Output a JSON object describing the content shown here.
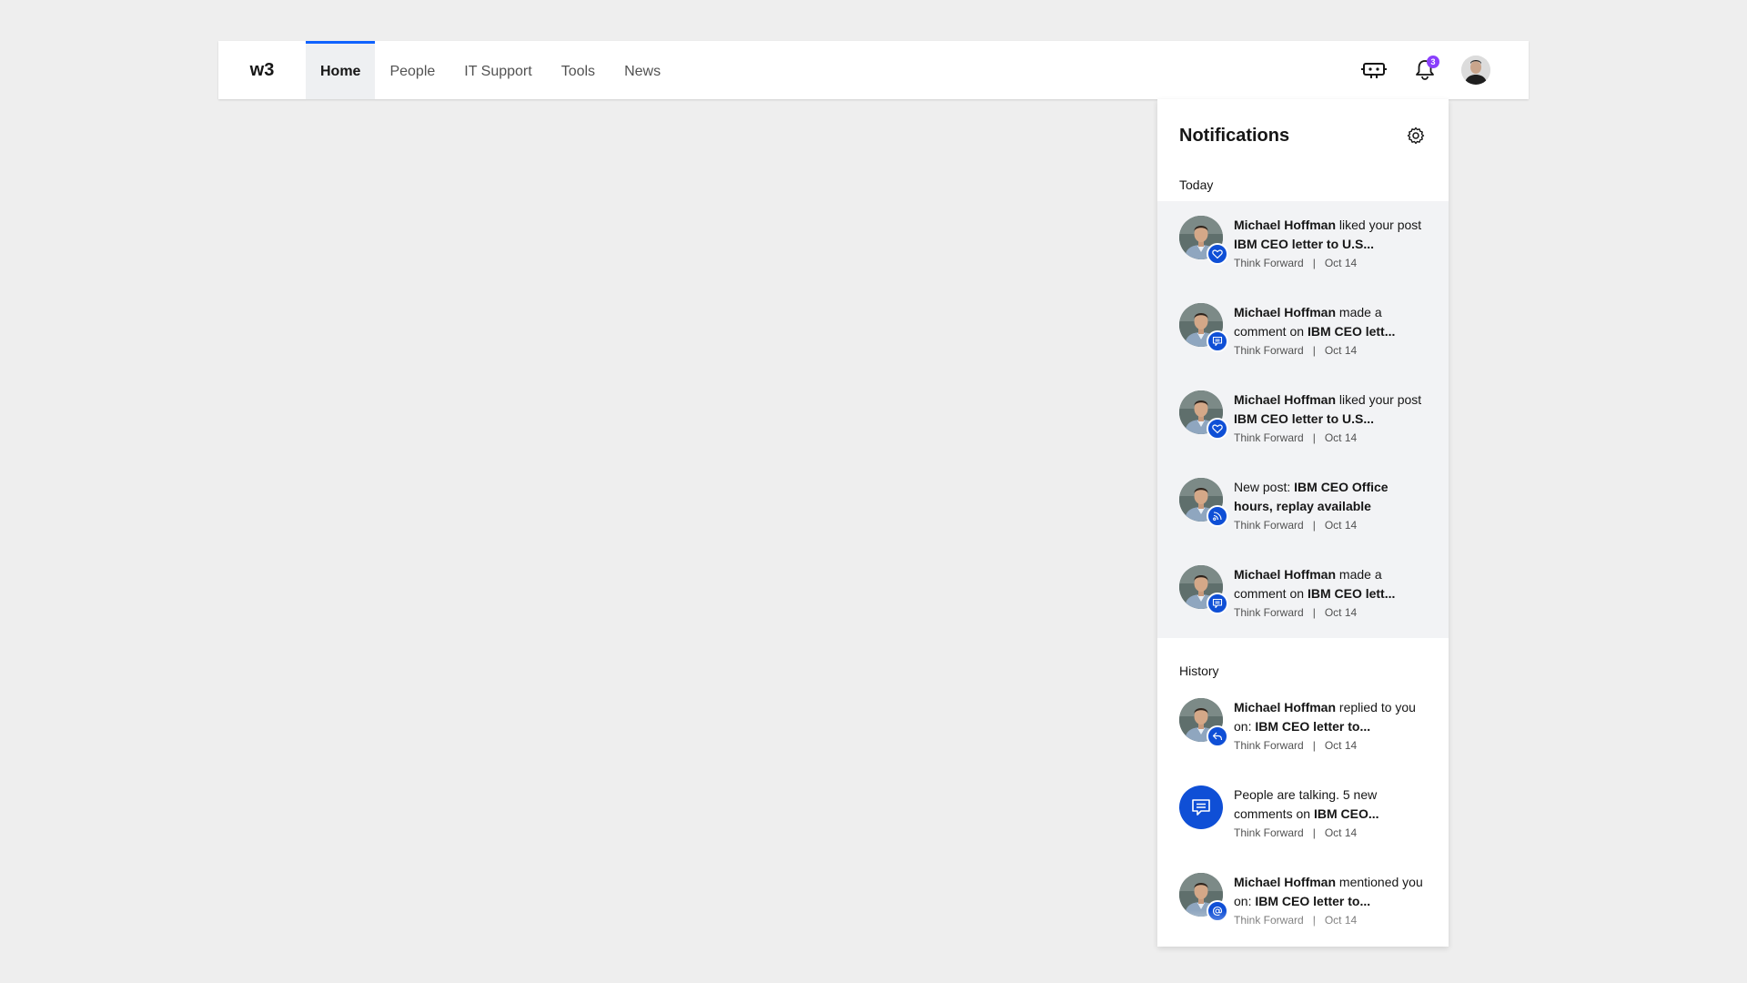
{
  "header": {
    "logo": "w3",
    "nav": [
      {
        "label": "Home",
        "active": true
      },
      {
        "label": "People"
      },
      {
        "label": "IT Support"
      },
      {
        "label": "Tools"
      },
      {
        "label": "News"
      }
    ],
    "notification_count": "3"
  },
  "panel": {
    "title": "Notifications",
    "today_label": "Today",
    "history_label": "History",
    "separator": "|",
    "today": [
      {
        "actor": "Michael Hoffman",
        "action": " liked your post ",
        "target": "IBM CEO letter to U.S...",
        "source": "Think Forward",
        "date": "Oct 14",
        "icon": "heart-icon"
      },
      {
        "actor": "Michael Hoffman",
        "action": " made a comment on ",
        "target": "IBM CEO lett...",
        "source": "Think Forward",
        "date": "Oct 14",
        "icon": "comment-icon"
      },
      {
        "actor": "Michael Hoffman",
        "action": " liked your post ",
        "target": "IBM CEO letter to U.S...",
        "source": "Think Forward",
        "date": "Oct 14",
        "icon": "heart-icon"
      },
      {
        "actor": "",
        "action": "New post: ",
        "target": "IBM CEO Office hours, replay available",
        "source": "Think Forward",
        "date": "Oct 14",
        "icon": "rss-icon"
      },
      {
        "actor": "Michael Hoffman",
        "action": " made a comment on ",
        "target": "IBM CEO lett...",
        "source": "Think Forward",
        "date": "Oct 14",
        "icon": "comment-icon"
      }
    ],
    "history": [
      {
        "actor": "Michael Hoffman",
        "action": " replied to you on: ",
        "target": "IBM CEO letter to...",
        "source": "Think Forward",
        "date": "Oct 14",
        "icon": "reply-icon"
      },
      {
        "actor": "",
        "action": "People are talking. 5 new comments on ",
        "target": "IBM CEO...",
        "source": "Think Forward",
        "date": "Oct 14",
        "icon": "comment-icon",
        "no_avatar": true
      },
      {
        "actor": "Michael Hoffman",
        "action": " mentioned you on: ",
        "target": "IBM CEO letter to...",
        "source": "Think Forward",
        "date": "Oct 14",
        "icon": "at-icon"
      }
    ]
  },
  "colors": {
    "accent": "#0f62fe",
    "icon_blue": "#0f4fd6",
    "badge": "#8a3ffc"
  }
}
